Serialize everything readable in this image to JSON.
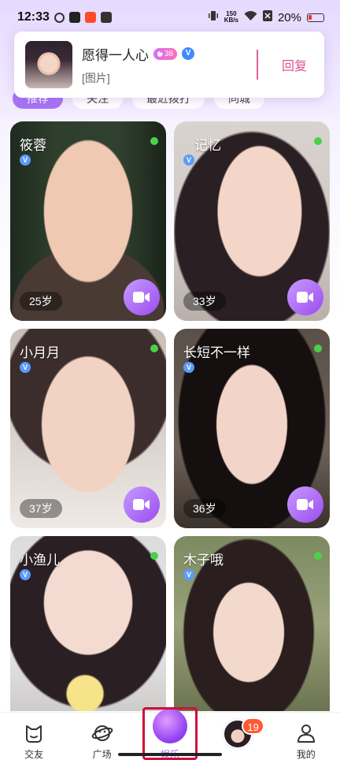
{
  "status_bar": {
    "time": "12:33",
    "net_speed_value": "150",
    "net_speed_unit": "KB/s",
    "battery": "20%"
  },
  "notification": {
    "name": "愿得一人心",
    "level": "38",
    "message": "[图片]",
    "reply_label": "回复"
  },
  "tabs": [
    "推荐",
    "关注",
    "最近拨打",
    "同城"
  ],
  "cards": [
    {
      "name": "筱蓉",
      "age": "25岁"
    },
    {
      "name": "记忆",
      "age": "33岁"
    },
    {
      "name": "小月月",
      "age": "37岁"
    },
    {
      "name": "长短不一样",
      "age": "36岁"
    },
    {
      "name": "小渔儿",
      "age": ""
    },
    {
      "name": "木子哦",
      "age": ""
    }
  ],
  "nav": {
    "items": [
      {
        "label": "交友"
      },
      {
        "label": "广场"
      },
      {
        "label": "娱乐"
      },
      {
        "label": ""
      },
      {
        "label": "我的"
      }
    ],
    "badge_count": "19"
  },
  "colors": {
    "accent": "#a466f2",
    "reply": "#e0508f",
    "online": "#4ad14a",
    "badge": "#ff5a33",
    "highlight": "#d0103a"
  }
}
